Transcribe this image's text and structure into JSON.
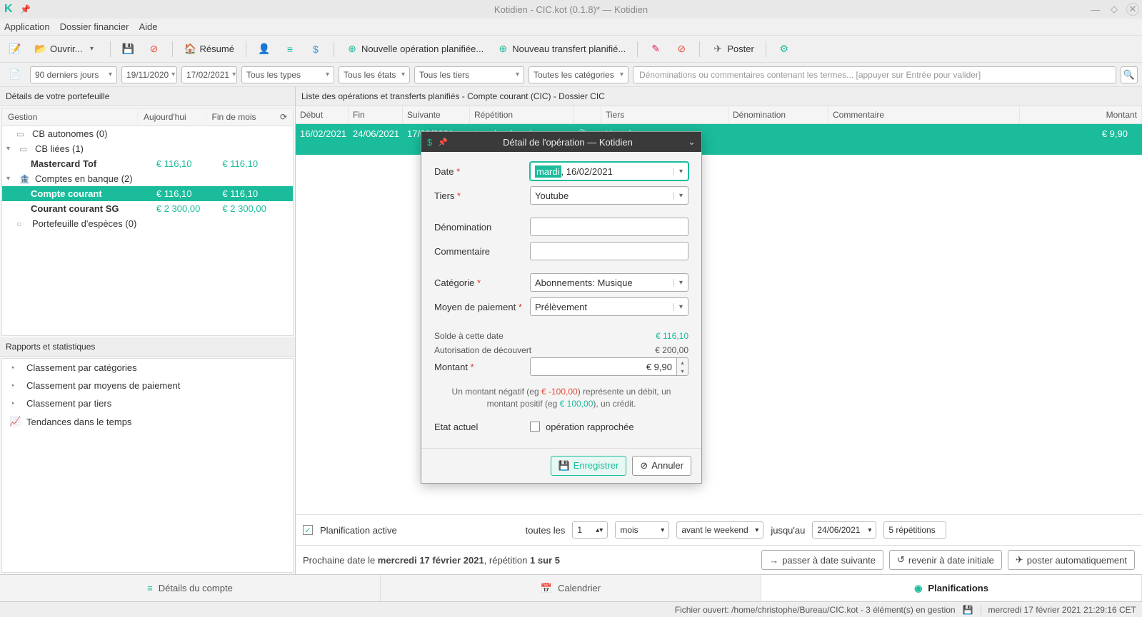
{
  "titlebar": {
    "title": "Kotidien - CIC.kot (0.1.8)* — Kotidien"
  },
  "menubar": {
    "app": "Application",
    "dossier": "Dossier financier",
    "aide": "Aide"
  },
  "toolbar": {
    "ouvrir": "Ouvrir...",
    "resume": "Résumé",
    "nouvOp": "Nouvelle opération planifiée...",
    "nouvTr": "Nouveau transfert planifié...",
    "poster": "Poster"
  },
  "filters": {
    "period": "90 derniers jours",
    "dateFrom": "19/11/2020",
    "dateTo": "17/02/2021",
    "types": "Tous les types",
    "etats": "Tous les états",
    "tiers": "Tous les tiers",
    "cats": "Toutes les catégories",
    "searchPlaceholder": "Dénominations ou commentaires contenant les termes... [appuyer sur Entrée pour valider]"
  },
  "portfolio": {
    "title": "Détails de votre portefeuille",
    "cols": {
      "gestion": "Gestion",
      "today": "Aujourd'hui",
      "eom": "Fin de mois"
    },
    "groups": {
      "cbAuto": "CB autonomes (0)",
      "cbLiees": "CB liées (1)",
      "mastercard": {
        "label": "Mastercard Tof",
        "today": "€ 116,10",
        "eom": "€ 116,10"
      },
      "comptes": "Comptes en banque (2)",
      "cc": {
        "label": "Compte courant",
        "today": "€ 116,10",
        "eom": "€ 116,10"
      },
      "sg": {
        "label": "Courant courant SG",
        "today": "€ 2 300,00",
        "eom": "€ 2 300,00"
      },
      "especes": "Portefeuille d'espèces (0)"
    }
  },
  "reports": {
    "title": "Rapports et statistiques",
    "items": [
      "Classement par catégories",
      "Classement par moyens de paiement",
      "Classement par tiers",
      "Tendances dans le temps"
    ]
  },
  "ops": {
    "title": "Liste des opérations et transferts planifiés - Compte courant (CIC) - Dossier CIC",
    "cols": {
      "debut": "Début",
      "fin": "Fin",
      "suiv": "Suivante",
      "rep": "Répétition",
      "tiers": "Tiers",
      "denom": "Dénomination",
      "comm": "Commentaire",
      "mont": "Montant"
    },
    "row": {
      "debut": "16/02/2021",
      "fin": "24/06/2021",
      "suiv": "17/02/2021",
      "rep": "tous les 1 mois",
      "tiers": "Youtube",
      "mont": "€ 9,90"
    }
  },
  "dialog": {
    "title": "Détail de l'opération — Kotidien",
    "dateLabel": "Date",
    "dateDay": "mardi",
    "dateVal": ", 16/02/2021",
    "tiersLabel": "Tiers",
    "tiersVal": "Youtube",
    "denomLabel": "Dénomination",
    "commLabel": "Commentaire",
    "catLabel": "Catégorie",
    "catVal": "Abonnements: Musique",
    "moyenLabel": "Moyen de paiement",
    "moyenVal": "Prélèvement",
    "soldeLabel": "Solde à cette date",
    "soldeVal": "€ 116,10",
    "decouvLabel": "Autorisation de découvert",
    "decouvVal": "€ 200,00",
    "montLabel": "Montant",
    "montVal": "€ 9,90",
    "hintPre": "Un montant négatif (eg ",
    "hintNeg": "€ -100,00",
    "hintMid": ") représente un débit, un montant positif (eg ",
    "hintPos": "€ 100,00",
    "hintEnd": "), un crédit.",
    "etatLabel": "Etat actuel",
    "rapprochee": "opération rapprochée",
    "save": "Enregistrer",
    "cancel": "Annuler"
  },
  "plan": {
    "active": "Planification active",
    "toutesLes": "toutes les",
    "count": "1",
    "unit": "mois",
    "when": "avant le weekend",
    "jusqu": "jusqu'au",
    "endDate": "24/06/2021",
    "reps": "5 répétitions",
    "nextPre": "Prochaine date le ",
    "nextDate": "mercredi 17 février 2021",
    "nextMid": ", répétition ",
    "nextRep": "1 sur 5",
    "btnNext": "passer à date suivante",
    "btnReset": "revenir à date initiale",
    "btnPost": "poster automatiquement"
  },
  "tabs": {
    "details": "Détails du compte",
    "cal": "Calendrier",
    "plan": "Planifications"
  },
  "status": {
    "file": "Fichier ouvert: /home/christophe/Bureau/CIC.kot - 3 élément(s) en gestion",
    "time": "mercredi 17 février 2021 21:29:16 CET"
  }
}
